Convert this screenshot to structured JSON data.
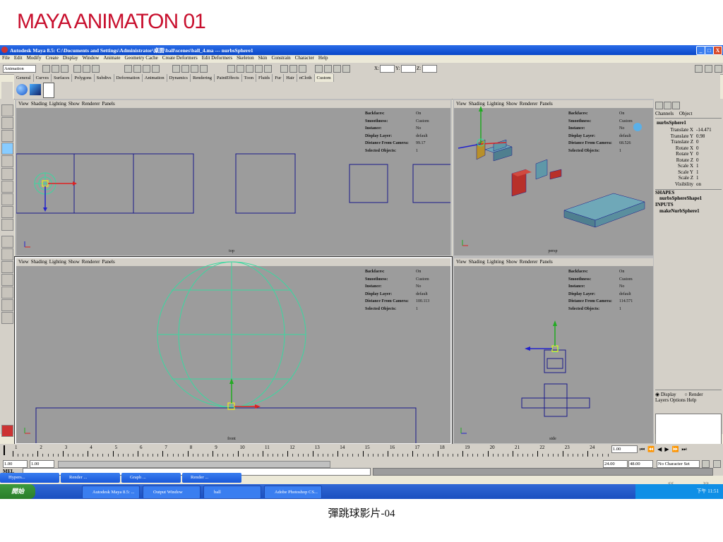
{
  "slide": {
    "title": "MAYA ANIMATON 01",
    "caption": "彈跳球影片-04"
  },
  "window": {
    "title": "Autodesk Maya 8.5: C:\\Documents and Settings\\Administrator\\桌面\\ball\\scenes\\ball_4.ma  ---  nurbsSphere1",
    "min": "_",
    "max": "□",
    "close": "X"
  },
  "menus": [
    "File",
    "Edit",
    "Modify",
    "Create",
    "Display",
    "Window",
    "Animate",
    "Geometry Cache",
    "Create Deformers",
    "Edit Deformers",
    "Skeleton",
    "Skin",
    "Constrain",
    "Character",
    "Help"
  ],
  "statusline": {
    "mode": "Animation",
    "x_label": "X:",
    "y_label": "Y:",
    "z_label": "Z:"
  },
  "shelf_tabs": [
    "General",
    "Curves",
    "Surfaces",
    "Polygons",
    "Subdivs",
    "Deformation",
    "Animation",
    "Dynamics",
    "Rendering",
    "PaintEffects",
    "Toon",
    "Fluids",
    "Fur",
    "Hair",
    "nCloth",
    "Custom"
  ],
  "viewport_menu": [
    "View",
    "Shading",
    "Lighting",
    "Show",
    "Renderer",
    "Panels"
  ],
  "hud_labels": [
    "Backfaces:",
    "Smoothness:",
    "Instance:",
    "Display Layer:",
    "Distance From Camera:",
    "Selected Objects:"
  ],
  "viewports": {
    "top": {
      "name": "top",
      "values": [
        "On",
        "Custom",
        "No",
        "default",
        "99.17",
        "1"
      ]
    },
    "persp": {
      "name": "persp",
      "values": [
        "On",
        "Custom",
        "No",
        "default",
        "68.526",
        "1"
      ]
    },
    "front": {
      "name": "front",
      "values": [
        "On",
        "Custom",
        "No",
        "default",
        "100.113",
        "1"
      ]
    },
    "side": {
      "name": "side",
      "values": [
        "On",
        "Custom",
        "No",
        "default",
        "114.571",
        "1"
      ]
    }
  },
  "channel_box": {
    "tabs": [
      "Channels",
      "Object"
    ],
    "object": "nurbsSphere1",
    "channels": [
      {
        "name": "Translate X",
        "value": "-14.471"
      },
      {
        "name": "Translate Y",
        "value": "0.98"
      },
      {
        "name": "Translate Z",
        "value": "0"
      },
      {
        "name": "Rotate X",
        "value": "0"
      },
      {
        "name": "Rotate Y",
        "value": "0"
      },
      {
        "name": "Rotate Z",
        "value": "0"
      },
      {
        "name": "Scale X",
        "value": "1"
      },
      {
        "name": "Scale Y",
        "value": "1"
      },
      {
        "name": "Scale Z",
        "value": "1"
      },
      {
        "name": "Visibility",
        "value": "on"
      }
    ],
    "shapes_header": "SHAPES",
    "shape": "nurbsSphereShape1",
    "inputs_header": "INPUTS",
    "input": "makeNurbSphere1"
  },
  "layers": {
    "display": "Display",
    "render": "Render",
    "menu": [
      "Layers",
      "Options",
      "Help"
    ],
    "nav": [
      "<<",
      ">>"
    ]
  },
  "timeline": {
    "ticks": [
      "1",
      "2",
      "3",
      "4",
      "5",
      "6",
      "7",
      "8",
      "9",
      "10",
      "11",
      "12",
      "13",
      "14",
      "15",
      "16",
      "17",
      "18",
      "19",
      "20",
      "21",
      "22",
      "23",
      "24"
    ],
    "current": "1.00"
  },
  "range": {
    "start": "1.00",
    "inner_start": "1.00",
    "inner_end": "24.00",
    "end": "48.00",
    "char_set": "No Character Set"
  },
  "cmdline_label": "MEL",
  "min_windows": [
    "Hypers...",
    "Render ...",
    "Graph ...",
    "Render ..."
  ],
  "taskbar": {
    "start": "開始",
    "tasks": [
      "Autodesk Maya 8.5: ...",
      "Output Window",
      "ball",
      "Adobe Photoshop CS..."
    ],
    "clock": "下午 11:51"
  },
  "colors": {
    "title_red": "#c8102e",
    "wire_blue": "#1a1a8a",
    "wire_green": "#3ad8a0",
    "cube_red": "#b8302a",
    "cube_teal": "#5f98a8",
    "cube_gold": "#b8902a"
  }
}
